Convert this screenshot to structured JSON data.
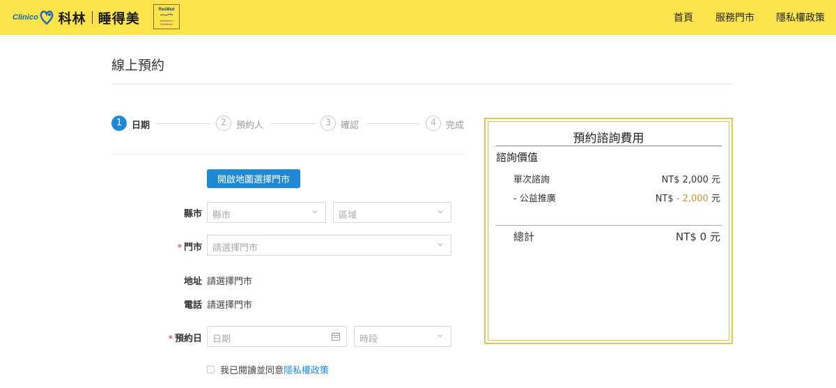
{
  "header": {
    "logo_text": "Clinico",
    "brand_name_1": "科林",
    "brand_name_2": "睡得美",
    "partner_logo_text": "ResMed",
    "partner_caption": "Authorized Distributor",
    "nav": [
      "首頁",
      "服務門市",
      "隱私權政策"
    ],
    "background": "#fbe44b"
  },
  "page": {
    "title": "線上預約"
  },
  "steps": [
    {
      "num": "1",
      "label": "日期",
      "active": true
    },
    {
      "num": "2",
      "label": "預約人",
      "active": false
    },
    {
      "num": "3",
      "label": "確認",
      "active": false
    },
    {
      "num": "4",
      "label": "完成",
      "active": false
    }
  ],
  "form": {
    "map_button": "開啟地圖選擇門市",
    "county_label": "縣市",
    "county_placeholder": "縣市",
    "district_placeholder": "區域",
    "store_label": "門市",
    "store_placeholder": "請選擇門市",
    "address_label": "地址",
    "address_value": "請選擇門市",
    "phone_label": "電話",
    "phone_value": "請選擇門市",
    "date_label": "預約日",
    "date_placeholder": "日期",
    "time_placeholder": "時段",
    "required_mark": "*",
    "agree_text": "我已閱讀並同意",
    "agree_link": "隱私權政策"
  },
  "fee": {
    "title": "預約諮詢費用",
    "section": "諮詢價值",
    "rows": [
      {
        "label": "單次諮詢",
        "prefix": "NT$ ",
        "amount": "2,000",
        "suffix": " 元"
      },
      {
        "label": "- 公益推廣",
        "prefix": "NT$ ",
        "amount": "- 2,000",
        "suffix": " 元"
      }
    ],
    "total_label": "總計",
    "total_value": "NT$ 0 元"
  },
  "colors": {
    "accent": "#1e8ad6",
    "gold": "#e0c64a",
    "discount": "#e08a2e",
    "required": "#e35d5d"
  }
}
